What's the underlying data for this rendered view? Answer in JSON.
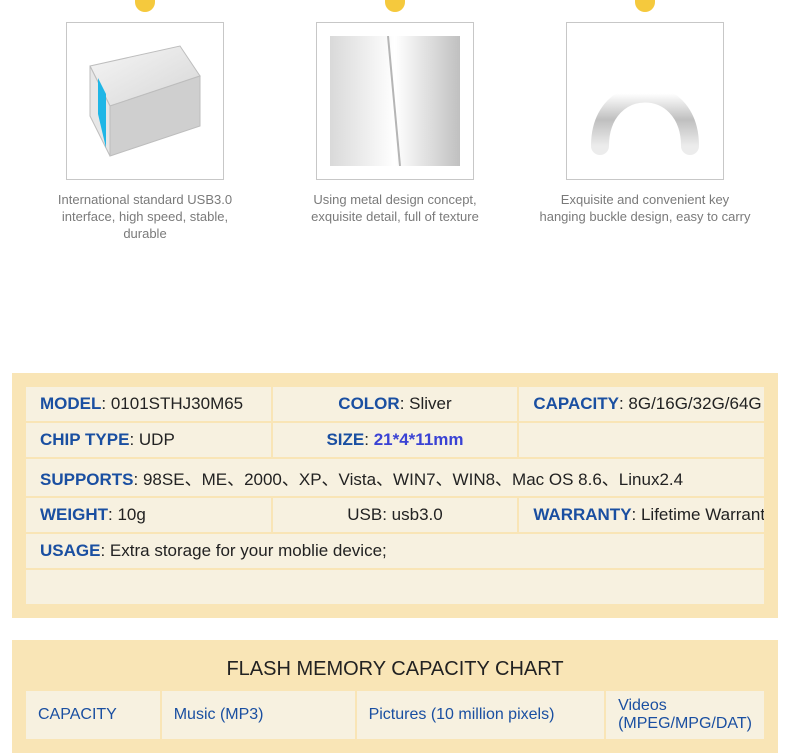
{
  "features": [
    {
      "caption": "International standard USB3.0 interface, high speed, stable, durable"
    },
    {
      "caption": "Using metal design concept, exquisite detail, full of texture"
    },
    {
      "caption": "Exquisite and convenient key hanging buckle design, easy to carry"
    }
  ],
  "spec": {
    "model_label": "MODEL",
    "model_value": ": 0101STHJ30M65",
    "color_label": "COLOR",
    "color_value": ": Sliver",
    "capacity_label": "CAPACITY",
    "capacity_value": ": 8G/16G/32G/64G",
    "chip_label": "CHIP TYPE",
    "chip_value": ": UDP",
    "size_label": "SIZE",
    "size_colon": ": ",
    "size_value": "21*4*11mm",
    "supports_label": "SUPPORTS",
    "supports_value": ": 98SE、ME、2000、XP、Vista、WIN7、WIN8、Mac OS 8.6、Linux2.4",
    "weight_label": "WEIGHT",
    "weight_value": ": 10g",
    "usb_label": "USB",
    "usb_value": ": usb3.0",
    "warranty_label": "WARRANTY",
    "warranty_value": ": Lifetime Warranty",
    "usage_label": "USAGE",
    "usage_value": ": Extra storage for your moblie device;"
  },
  "chart": {
    "title": "FLASH MEMORY CAPACITY CHART",
    "headers": {
      "capacity": "CAPACITY",
      "music": "Music (MP3)",
      "pictures": "Pictures (10 million pixels)",
      "videos": "Videos (MPEG/MPG/DAT)"
    }
  }
}
